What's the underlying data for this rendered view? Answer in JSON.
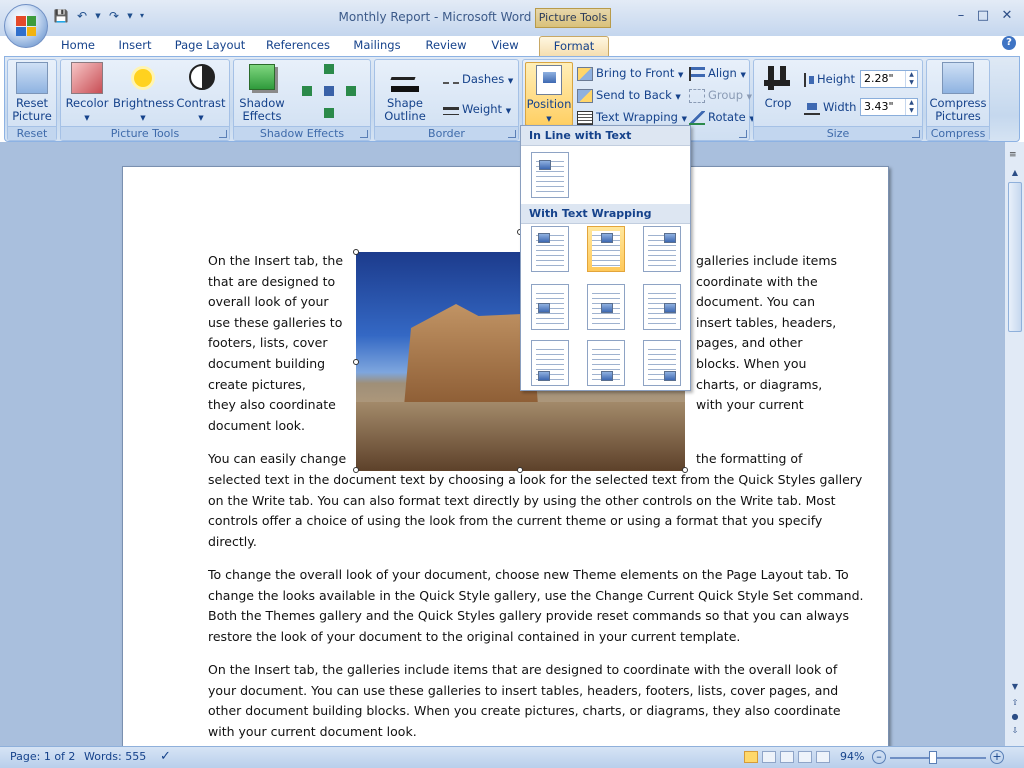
{
  "title": {
    "doc": "Monthly Report",
    "sep": " - ",
    "app": "Microsoft Word",
    "contextual": "Picture Tools"
  },
  "tabs": [
    "Home",
    "Insert",
    "Page Layout",
    "References",
    "Mailings",
    "Review",
    "View",
    "Format"
  ],
  "groups": {
    "reset": {
      "label": "Reset",
      "button": "Reset\nPicture"
    },
    "picture_tools": {
      "label": "Picture Tools",
      "recolor": "Recolor",
      "brightness": "Brightness",
      "contrast": "Contrast"
    },
    "shadow": {
      "label": "Shadow Effects",
      "button": "Shadow\nEffects"
    },
    "border": {
      "label": "Border",
      "shape_outline": "Shape\nOutline",
      "dashes": "Dashes",
      "weight": "Weight"
    },
    "arrange": {
      "position": "Position",
      "bring_to_front": "Bring to Front",
      "send_to_back": "Send to Back",
      "text_wrapping": "Text Wrapping",
      "align": "Align",
      "group": "Group",
      "rotate": "Rotate"
    },
    "size": {
      "label": "Size",
      "crop": "Crop",
      "height_label": "Height",
      "height_value": "2.28\"",
      "width_label": "Width",
      "width_value": "3.43\""
    },
    "compress": {
      "label": "Compress",
      "button": "Compress\nPictures"
    }
  },
  "dropdown": {
    "inline_header": "In Line with Text",
    "wrap_header": "With Text Wrapping"
  },
  "document": {
    "left_lines": [
      "On the Insert tab, the",
      "that are designed to",
      "overall look of your",
      "use these galleries to",
      "footers, lists, cover",
      "document building",
      "create pictures,",
      "they also coordinate",
      "document look."
    ],
    "right_lines": [
      "galleries include items",
      "coordinate with the",
      "document.  You can",
      "insert tables, headers,",
      "pages, and other",
      "blocks.  When you",
      "charts, or diagrams,",
      "with your current"
    ],
    "p2_first_left": "You can easily change",
    "p2_first_right": "the formatting of",
    "p2_lines": [
      "selected text in the document text by choosing a look for the selected text from the Quick Styles gallery",
      "on the Write tab.  You can also format text directly by using the other controls on the Write tab.  Most",
      "controls offer a choice of using the look from the current theme or using a format that you specify",
      "directly."
    ],
    "p3_lines": [
      "To change the overall look of your document, choose new Theme elements on the Page Layout tab.  To",
      "change the looks available in the Quick Style gallery, use the Change Current Quick Style Set command.",
      "Both the Themes gallery and the Quick Styles gallery provide reset commands so that you can always",
      "restore the look of your document to the original contained in your current template."
    ],
    "p4_lines": [
      "On the Insert tab, the galleries include items that are designed to coordinate with the overall look of",
      "your document.  You can use these galleries to insert tables, headers, footers, lists, cover pages, and",
      "other document building blocks.  When you create pictures, charts, or diagrams, they also coordinate",
      "with your current document look."
    ]
  },
  "status": {
    "page": "Page: 1 of 2",
    "words": "Words: 555",
    "zoom": "94%"
  },
  "colors": {
    "accent": "#15428b",
    "ribbon": "#c5d8ee",
    "selected": "#ffc95a"
  }
}
